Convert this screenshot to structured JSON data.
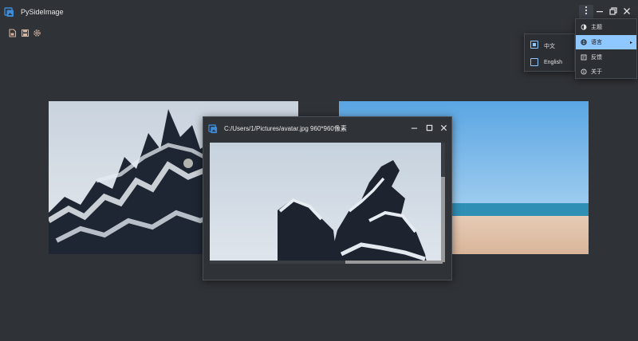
{
  "app": {
    "title": "PySideImage"
  },
  "window_buttons": {
    "menu_icon": "kebab-menu-icon",
    "minimize_icon": "minimize-icon",
    "restore_icon": "restore-icon",
    "close_icon": "close-icon"
  },
  "toolbar": {
    "icons": [
      "open-file-icon",
      "save-icon",
      "settings-icon"
    ]
  },
  "viewer": {
    "title": "C:/Users/1/Pictures/avatar.jpg  960*960像素"
  },
  "main_menu": {
    "items": [
      {
        "label": "主题",
        "icon": "theme-icon"
      },
      {
        "label": "语言",
        "icon": "globe-icon",
        "arrow": "▸"
      },
      {
        "label": "反馈",
        "icon": "feedback-icon"
      },
      {
        "label": "关于",
        "icon": "about-icon"
      }
    ]
  },
  "lang_menu": {
    "items": [
      {
        "label": "中文",
        "checked": true
      },
      {
        "label": "English",
        "checked": false
      }
    ]
  },
  "colors": {
    "background": "#2f3237",
    "accent": "#8fc7ff",
    "app_icon": "#3d8bd9"
  }
}
